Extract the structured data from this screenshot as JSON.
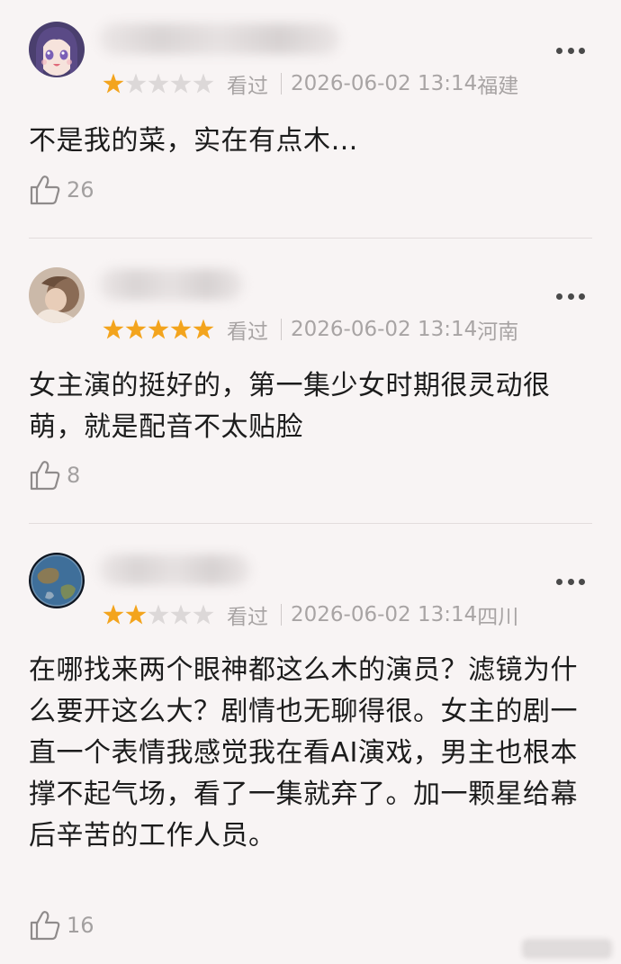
{
  "reviews": [
    {
      "username": "████",
      "rating": 1,
      "stars": [
        1,
        0,
        0,
        0,
        0
      ],
      "status": "看过",
      "datetime": "2026-06-02 13:14",
      "location": "福建",
      "comment": "不是我的菜，实在有点木…",
      "likes": "26",
      "avatar": "anime-girl-avatar"
    },
    {
      "username": "████",
      "rating": 5,
      "stars": [
        1,
        1,
        1,
        1,
        1
      ],
      "status": "看过",
      "datetime": "2026-06-02 13:14",
      "location": "河南",
      "comment": "女主演的挺好的，第一集少女时期很灵动很萌，就是配音不太贴脸",
      "likes": "8",
      "avatar": "photo-avatar"
    },
    {
      "username": "████",
      "rating": 2,
      "stars": [
        1,
        1,
        0,
        0,
        0
      ],
      "status": "看过",
      "datetime": "2026-06-02 13:14",
      "location": "四川",
      "comment": "在哪找来两个眼神都这么木的演员？滤镜为什么要开这么大？剧情也无聊得很。女主的剧一直一个表情我感觉我在看AI演戏，男主也根本撑不起气场，看了一集就弃了。加一颗星给幕后辛苦的工作人员。",
      "likes": "16",
      "avatar": "earth-avatar"
    }
  ],
  "colors": {
    "background": "#f8f4f4",
    "star_on": "#f3a41d",
    "star_off": "#dcd8d8",
    "meta_text": "#a8a4a4"
  }
}
